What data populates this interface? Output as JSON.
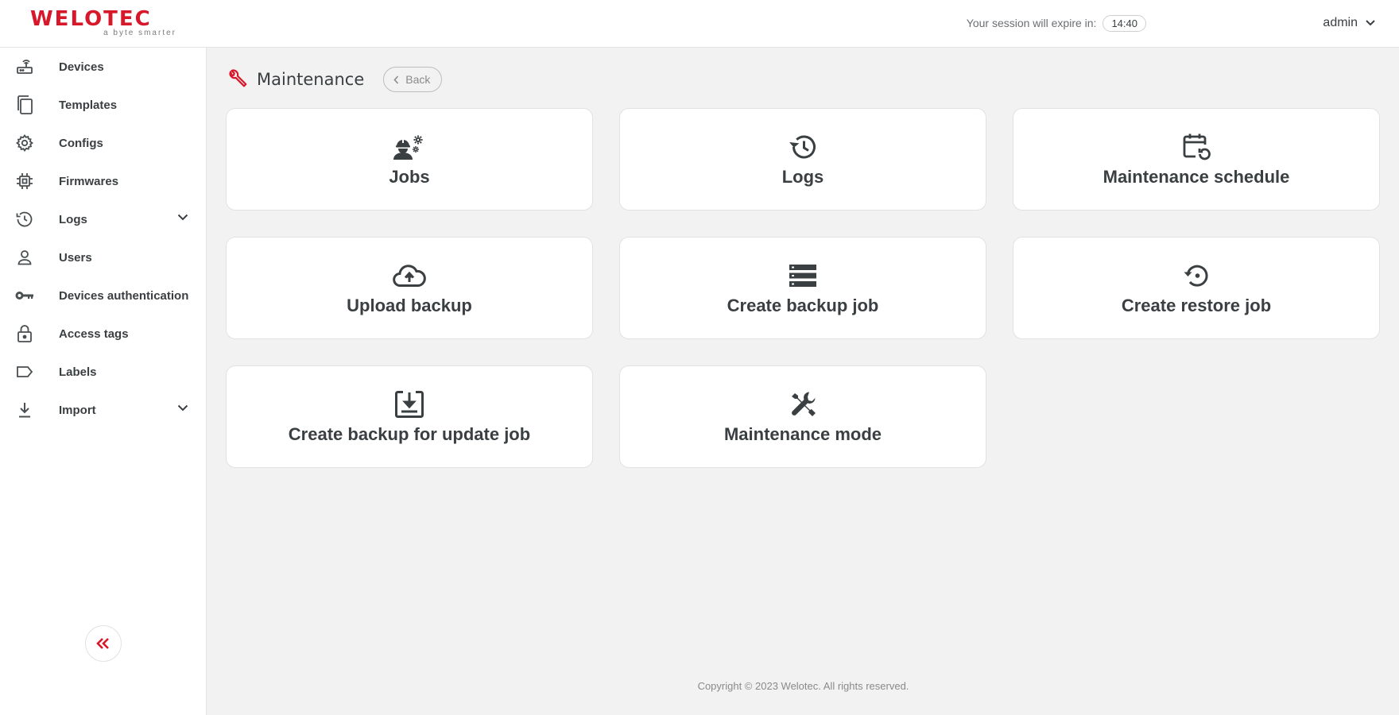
{
  "brand": {
    "name": "WELOTEC",
    "tagline": "a byte smarter",
    "accent_color": "#d7182a"
  },
  "header": {
    "session_label": "Your session will expire in:",
    "session_timer": "14:40",
    "user_name": "admin",
    "user_icon": "chevron-down-icon"
  },
  "sidebar": {
    "items": [
      {
        "label": "Devices",
        "icon": "router-icon"
      },
      {
        "label": "Templates",
        "icon": "copy-icon"
      },
      {
        "label": "Configs",
        "icon": "gear-icon"
      },
      {
        "label": "Firmwares",
        "icon": "chip-icon"
      },
      {
        "label": "Logs",
        "icon": "history-icon",
        "expandable": true
      },
      {
        "label": "Users",
        "icon": "user-icon"
      },
      {
        "label": "Devices authentication",
        "icon": "key-icon"
      },
      {
        "label": "Access tags",
        "icon": "lock-icon"
      },
      {
        "label": "Labels",
        "icon": "label-icon"
      },
      {
        "label": "Import",
        "icon": "download-icon",
        "expandable": true
      }
    ],
    "collapse_icon": "double-chevron-left-icon"
  },
  "page": {
    "title": "Maintenance",
    "title_icon": "wrench-icon",
    "back_label": "Back"
  },
  "cards": [
    {
      "label": "Jobs",
      "icon": "worker-gears-icon"
    },
    {
      "label": "Logs",
      "icon": "history-icon"
    },
    {
      "label": "Maintenance schedule",
      "icon": "calendar-refresh-icon"
    },
    {
      "label": "Upload backup",
      "icon": "cloud-upload-icon"
    },
    {
      "label": "Create backup job",
      "icon": "storage-icon"
    },
    {
      "label": "Create restore job",
      "icon": "restore-icon"
    },
    {
      "label": "Create backup for update job",
      "icon": "download-box-icon"
    },
    {
      "label": "Maintenance mode",
      "icon": "tools-icon"
    }
  ],
  "footer": {
    "copyright": "Copyright © 2023 Welotec. All rights reserved."
  }
}
